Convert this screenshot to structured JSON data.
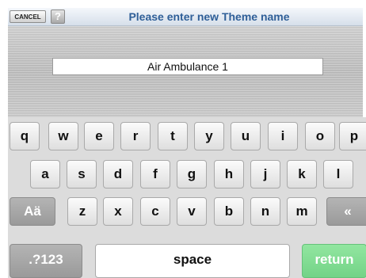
{
  "header": {
    "cancel_label": "CANCEL",
    "help_symbol": "?",
    "title": "Please enter new Theme name"
  },
  "name_input": {
    "value": "Air Ambulance 1"
  },
  "keyboard": {
    "row1": [
      "q",
      "w",
      "e",
      "r",
      "t",
      "y",
      "u",
      "i",
      "o",
      "p"
    ],
    "row2": [
      "a",
      "s",
      "d",
      "f",
      "g",
      "h",
      "j",
      "k",
      "l"
    ],
    "row3": [
      "z",
      "x",
      "c",
      "v",
      "b",
      "n",
      "m"
    ],
    "shift_label": "Aä",
    "backspace_label": "«",
    "numbers_label": ".?123",
    "space_label": "space",
    "return_label": "return"
  }
}
